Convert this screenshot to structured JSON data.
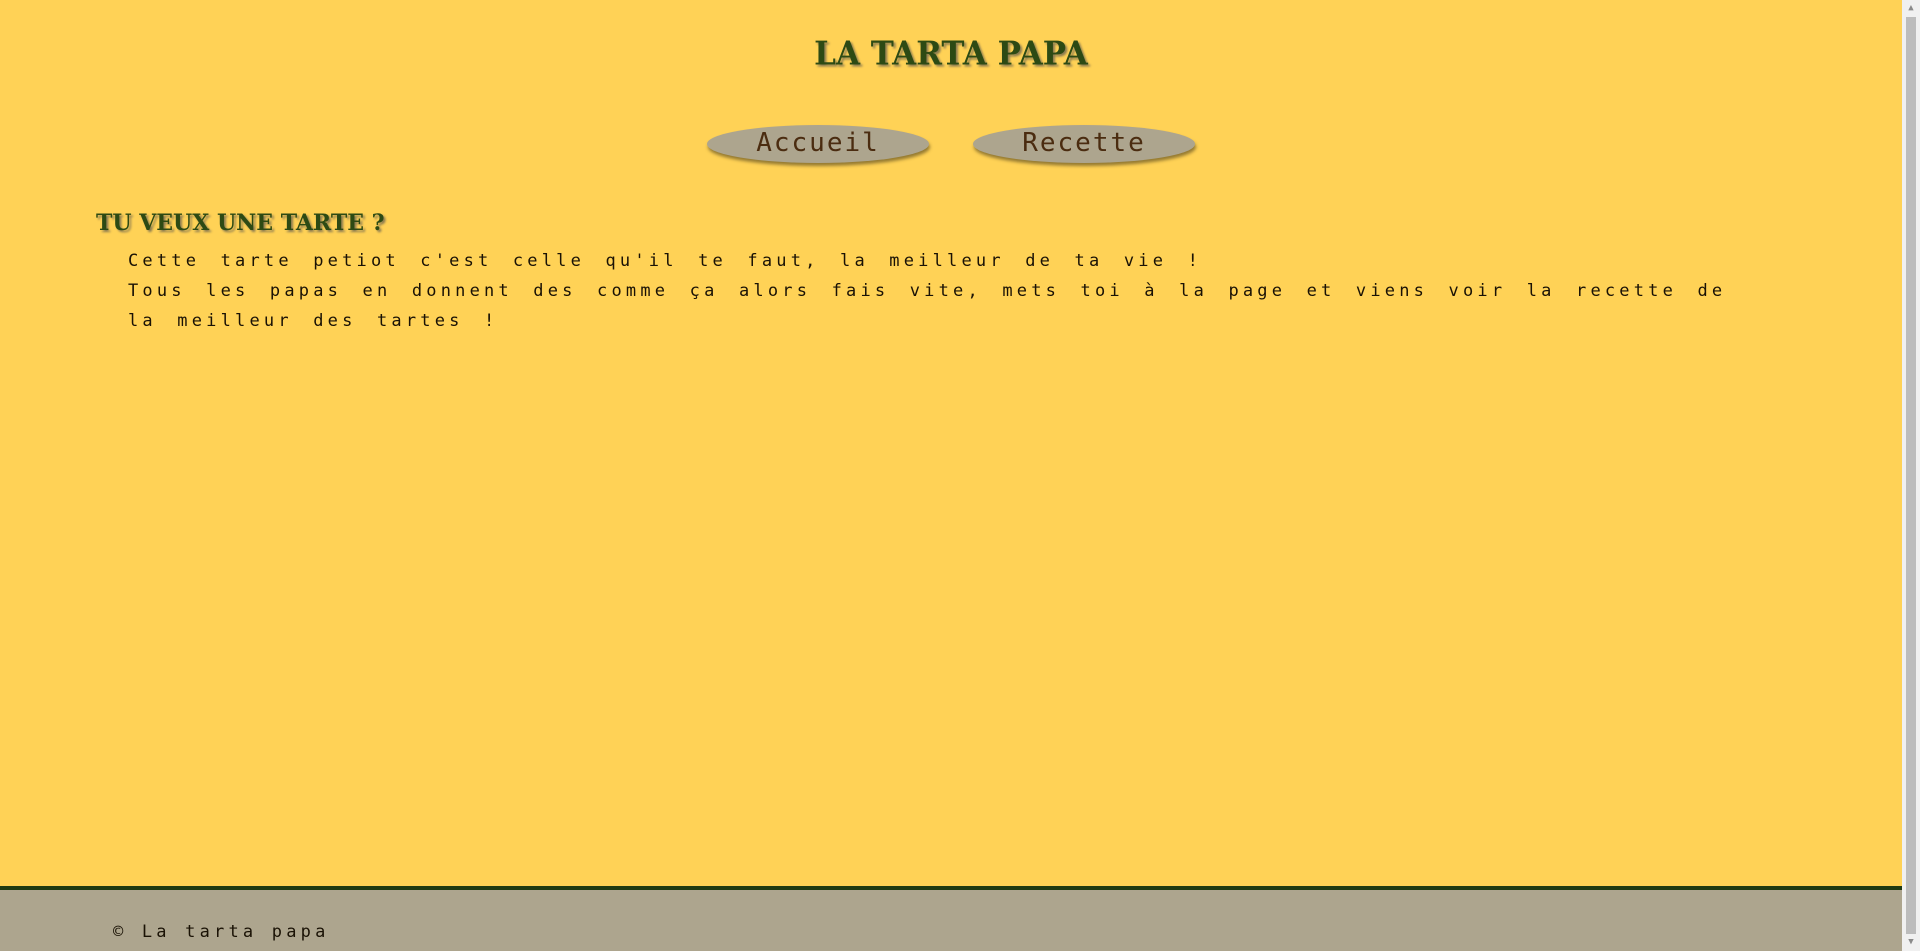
{
  "header": {
    "site_title": "LA TARTA PAPA"
  },
  "nav": {
    "items": [
      {
        "label": "Accueil"
      },
      {
        "label": "Recette"
      }
    ]
  },
  "main": {
    "heading": "TU VEUX UNE TARTE ?",
    "paragraphs": [
      "Cette tarte petiot c'est celle qu'il te faut, la meilleur de ta vie !",
      "Tous les papas en donnent des comme ça alors fais vite, mets toi à la page et viens voir la recette de la meilleur des tartes !"
    ]
  },
  "footer": {
    "copyright": "© La tarta papa"
  },
  "scrollbar": {
    "up_icon": "scroll-up-arrow",
    "down_icon": "scroll-down-arrow"
  },
  "colors": {
    "background": "#ffd256",
    "title_green": "#2d4a14",
    "button_taupe": "#ada58e",
    "button_text_brown": "#4b2c10",
    "footer_border": "#1f3a12"
  }
}
